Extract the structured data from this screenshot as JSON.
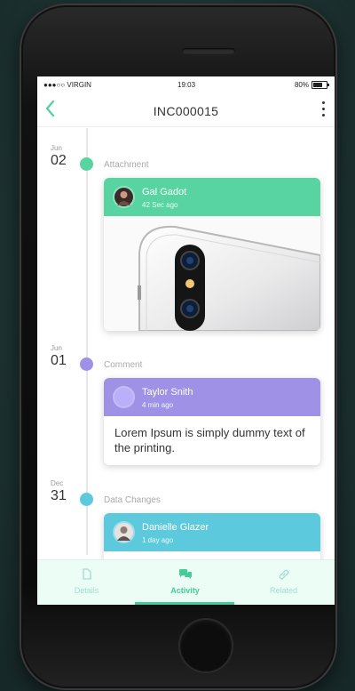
{
  "status_bar": {
    "carrier": "●●●○○ VIRGIN",
    "time": "19:03",
    "battery": "80%"
  },
  "header": {
    "title": "INC000015"
  },
  "timeline": [
    {
      "month": "Jun",
      "day": "02",
      "type": "Attachment",
      "color": "#57d4a1",
      "user": "Gal Gadot",
      "time": "42 Sec ago"
    },
    {
      "month": "Jun",
      "day": "01",
      "type": "Comment",
      "color": "#9f91e6",
      "user": "Taylor Snith",
      "time": "4 min ago",
      "body": "Lorem Ipsum is simply dummy text of the printing."
    },
    {
      "month": "Dec",
      "day": "31",
      "type": "Data Changes",
      "color": "#5cc9dd",
      "user": "Danielle Glazer",
      "time": "1 day ago"
    }
  ],
  "tabs": [
    {
      "label": "Details",
      "icon": "document-icon"
    },
    {
      "label": "Activity",
      "icon": "chat-icon"
    },
    {
      "label": "Related",
      "icon": "link-icon"
    }
  ],
  "active_tab": "Activity",
  "colors": {
    "accent": "#43cc98"
  }
}
